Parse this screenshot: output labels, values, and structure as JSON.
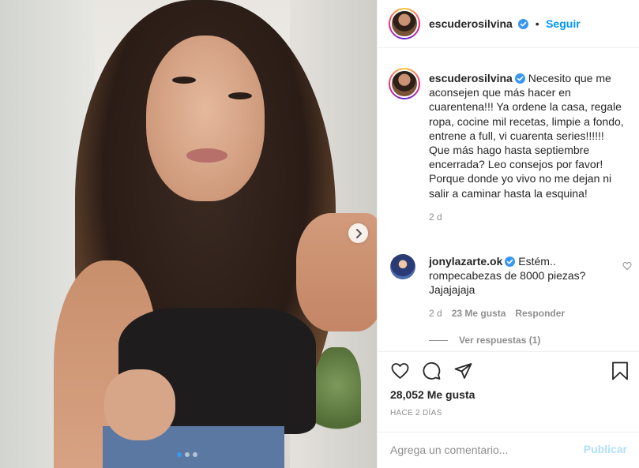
{
  "post": {
    "username": "escuderosilvina",
    "follow_label": "Seguir",
    "separator": "•",
    "caption": "Necesito que me aconsejen que más hacer en cuarentena!!! Ya ordene la casa, regale ropa, cocine mil recetas, limpie a fondo, entrene a full, vi cuarenta series!!!!!! Que más hago hasta septiembre encerrada? Leo consejos por favor! Porque donde yo vivo no me dejan ni salir a caminar hasta la esquina!",
    "caption_time": "2 d",
    "likes": "28,052 Me gusta",
    "posted_ago": "HACE 2 DÍAS",
    "carousel": {
      "current": 1,
      "total": 3
    }
  },
  "comment": {
    "username": "jonylazarte.ok",
    "text": "Estém.. rompecabezas de 8000 piezas? Jajajajaja",
    "time": "2 d",
    "likes": "23 Me gusta",
    "reply_label": "Responder",
    "view_replies": "Ver respuestas (1)"
  },
  "comment_input": {
    "placeholder": "Agrega un comentario...",
    "publish_label": "Publicar"
  },
  "colors": {
    "accent": "#0095f6",
    "verified": "#3897f0",
    "muted": "#8e8e8e"
  }
}
